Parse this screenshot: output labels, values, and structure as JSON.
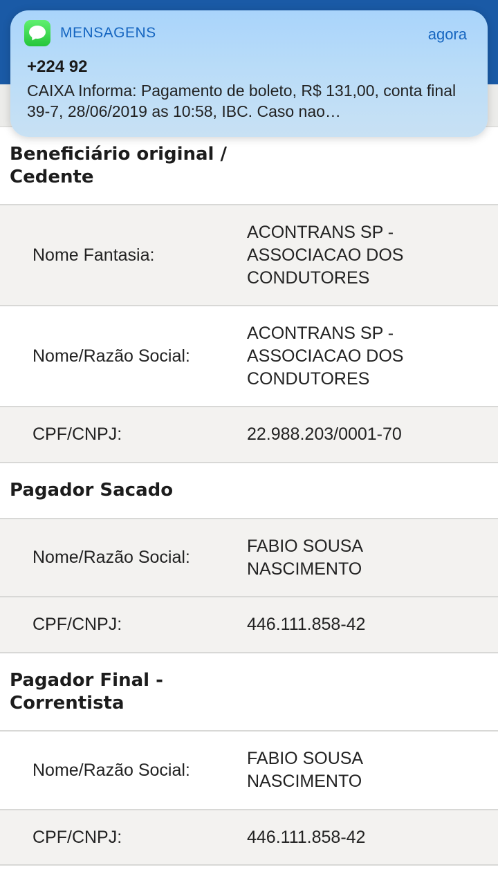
{
  "notification": {
    "app_name": "MENSAGENS",
    "icon": "messages-icon",
    "time": "agora",
    "sender": "+224 92",
    "body": "CAIXA Informa: Pagamento de boleto, R$ 131,00, conta final 39-7, 28/06/2019 as 10:58, IBC. Caso nao…"
  },
  "sections": {
    "beneficiario": {
      "title": "Beneficiário original / Cedente",
      "nome_fantasia_label": "Nome Fantasia:",
      "nome_fantasia_value": "ACONTRANS SP - ASSOCIACAO DOS CONDUTORES",
      "razao_label": "Nome/Razão Social:",
      "razao_value": "ACONTRANS SP - ASSOCIACAO DOS CONDUTORES",
      "cpf_label": "CPF/CNPJ:",
      "cpf_value": "22.988.203/0001-70"
    },
    "pagador_sacado": {
      "title": "Pagador Sacado",
      "razao_label": "Nome/Razão Social:",
      "razao_value": "FABIO SOUSA NASCIMENTO",
      "cpf_label": "CPF/CNPJ:",
      "cpf_value": "446.111.858-42"
    },
    "pagador_final": {
      "title": "Pagador Final - Correntista",
      "razao_label": "Nome/Razão Social:",
      "razao_value": "FABIO SOUSA NASCIMENTO",
      "cpf_label": "CPF/CNPJ:",
      "cpf_value": "446.111.858-42"
    }
  },
  "colors": {
    "header_blue": "#1a5aa6",
    "row_grey": "#f3f2f0",
    "notification_accent": "#1565c0",
    "messages_green": "#25c53a"
  }
}
